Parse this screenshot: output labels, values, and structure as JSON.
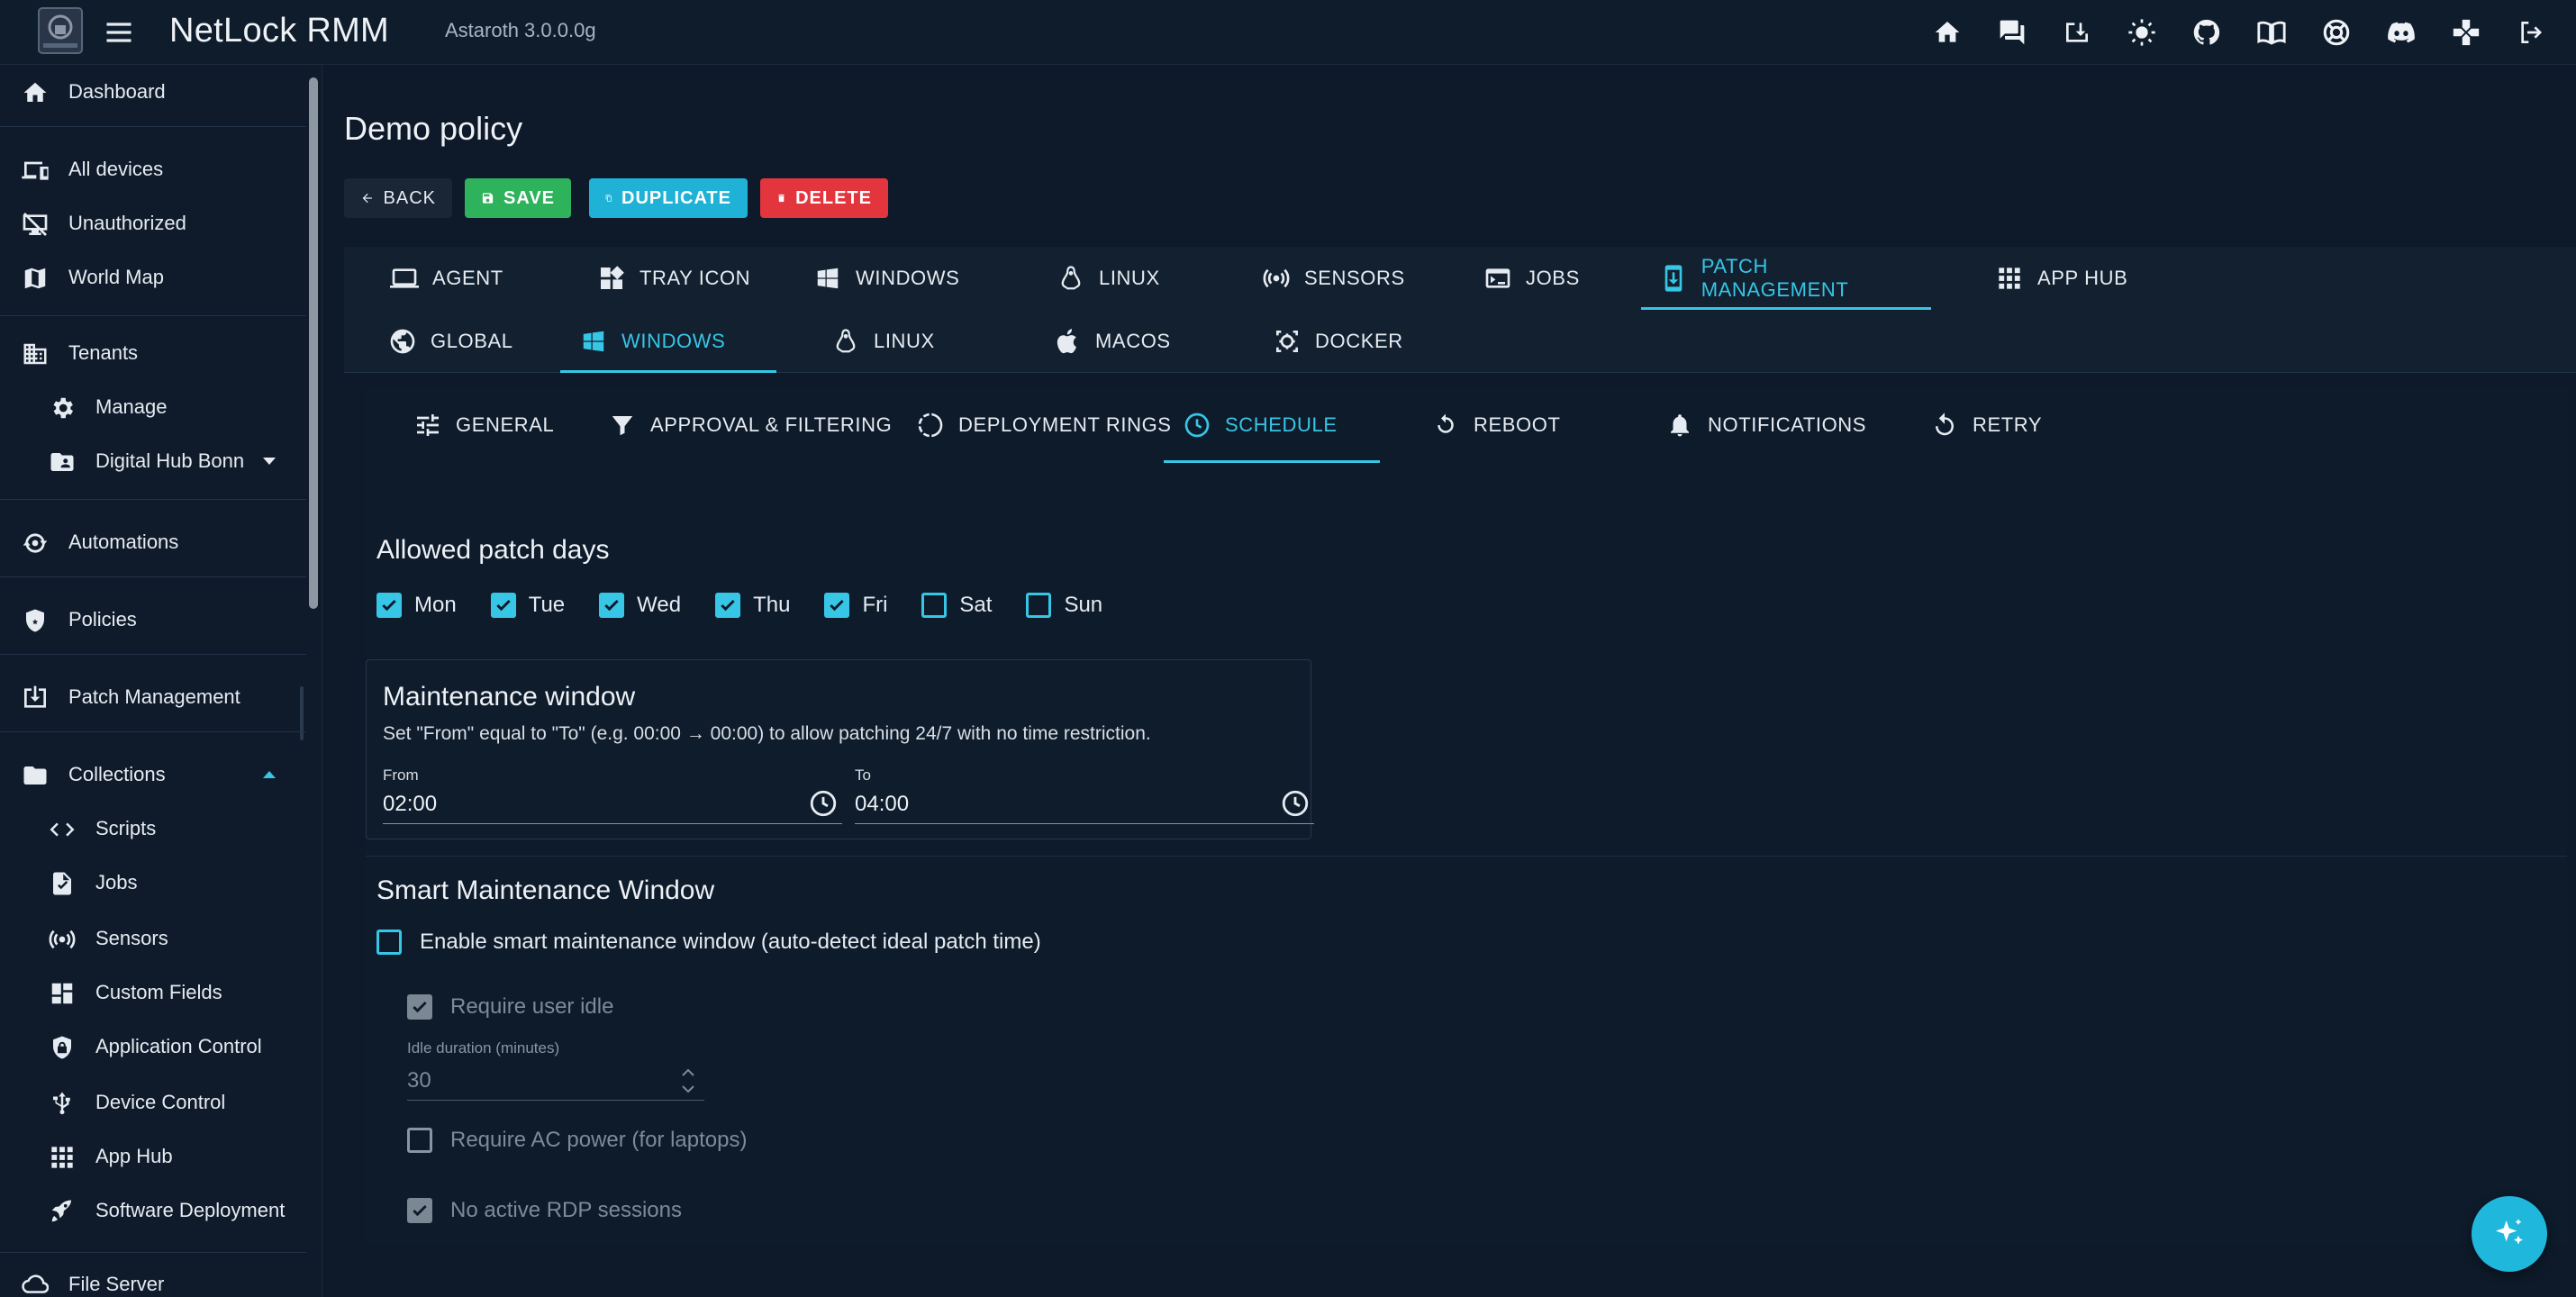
{
  "app": {
    "title": "NetLock RMM",
    "version": "Astaroth 3.0.0.0g"
  },
  "topbar_icons": [
    "home-icon",
    "chat-icon",
    "download-icon",
    "theme-icon",
    "github-icon",
    "docs-icon",
    "support-icon",
    "discord-icon",
    "gamepad-icon",
    "logout-icon"
  ],
  "sidebar": {
    "items": [
      {
        "label": "Dashboard",
        "icon": "home-icon"
      },
      {
        "label": "All devices",
        "icon": "devices-icon"
      },
      {
        "label": "Unauthorized",
        "icon": "unauthorized-icon"
      },
      {
        "label": "World Map",
        "icon": "map-icon"
      },
      {
        "label": "Tenants",
        "icon": "building-icon"
      },
      {
        "label": "Manage",
        "icon": "gear-icon"
      },
      {
        "label": "Digital Hub Bonn",
        "icon": "folder-account-icon"
      },
      {
        "label": "Automations",
        "icon": "automation-icon"
      },
      {
        "label": "Policies",
        "icon": "shield-icon"
      },
      {
        "label": "Patch Management",
        "icon": "patch-icon"
      },
      {
        "label": "Collections",
        "icon": "folder-icon"
      },
      {
        "label": "Scripts",
        "icon": "code-icon"
      },
      {
        "label": "Jobs",
        "icon": "job-icon"
      },
      {
        "label": "Sensors",
        "icon": "sensor-icon"
      },
      {
        "label": "Custom Fields",
        "icon": "dashboard-icon"
      },
      {
        "label": "Application Control",
        "icon": "shield-lock-icon"
      },
      {
        "label": "Device Control",
        "icon": "usb-icon"
      },
      {
        "label": "App Hub",
        "icon": "apps-icon"
      },
      {
        "label": "Software Deployment",
        "icon": "rocket-icon"
      },
      {
        "label": "File Server",
        "icon": "cloud-icon"
      }
    ]
  },
  "page": {
    "title": "Demo policy",
    "buttons": {
      "back": "BACK",
      "save": "SAVE",
      "duplicate": "DUPLICATE",
      "delete": "DELETE"
    }
  },
  "tabs_main": [
    {
      "label": "AGENT",
      "icon": "laptop-icon"
    },
    {
      "label": "TRAY ICON",
      "icon": "widgets-icon"
    },
    {
      "label": "WINDOWS",
      "icon": "windows-icon"
    },
    {
      "label": "LINUX",
      "icon": "linux-icon"
    },
    {
      "label": "SENSORS",
      "icon": "sensor-icon"
    },
    {
      "label": "JOBS",
      "icon": "console-icon"
    },
    {
      "label": "PATCH MANAGEMENT",
      "icon": "phone-download-icon",
      "active": true
    },
    {
      "label": "APP HUB",
      "icon": "apps-icon"
    }
  ],
  "tabs_os": [
    {
      "label": "GLOBAL",
      "icon": "globe-icon"
    },
    {
      "label": "WINDOWS",
      "icon": "windows-icon",
      "active": true
    },
    {
      "label": "LINUX",
      "icon": "linux-icon"
    },
    {
      "label": "MACOS",
      "icon": "apple-icon"
    },
    {
      "label": "DOCKER",
      "icon": "docker-icon"
    }
  ],
  "tabs_sub": [
    {
      "label": "GENERAL",
      "icon": "tune-icon"
    },
    {
      "label": "APPROVAL & FILTERING",
      "icon": "filter-icon"
    },
    {
      "label": "DEPLOYMENT RINGS",
      "icon": "rings-icon"
    },
    {
      "label": "SCHEDULE",
      "icon": "clock-icon",
      "active": true
    },
    {
      "label": "REBOOT",
      "icon": "restart-icon"
    },
    {
      "label": "NOTIFICATIONS",
      "icon": "bell-icon"
    },
    {
      "label": "RETRY",
      "icon": "retry-icon"
    }
  ],
  "schedule": {
    "patch_days_title": "Allowed patch days",
    "days": [
      {
        "label": "Mon",
        "checked": true
      },
      {
        "label": "Tue",
        "checked": true
      },
      {
        "label": "Wed",
        "checked": true
      },
      {
        "label": "Thu",
        "checked": true
      },
      {
        "label": "Fri",
        "checked": true
      },
      {
        "label": "Sat",
        "checked": false
      },
      {
        "label": "Sun",
        "checked": false
      }
    ],
    "maintenance": {
      "title": "Maintenance window",
      "description": "Set \"From\" equal to \"To\" (e.g. 00:00 → 00:00) to allow patching 24/7 with no time restriction.",
      "from_label": "From",
      "from_value": "02:00",
      "to_label": "To",
      "to_value": "04:00"
    },
    "smart": {
      "title": "Smart Maintenance Window",
      "enable_label": "Enable smart maintenance window (auto-detect ideal patch time)",
      "enable_checked": false,
      "require_idle_label": "Require user idle",
      "require_idle_checked": true,
      "idle_duration_label": "Idle duration (minutes)",
      "idle_duration_value": "30",
      "require_ac_label": "Require AC power (for laptops)",
      "require_ac_checked": false,
      "no_rdp_label": "No active RDP sessions",
      "no_rdp_checked": true
    }
  },
  "colors": {
    "accent": "#37c6e6",
    "save": "#2eb25c",
    "duplicate": "#1fb2d6",
    "delete": "#e2353d",
    "background": "#0e1a2a"
  }
}
